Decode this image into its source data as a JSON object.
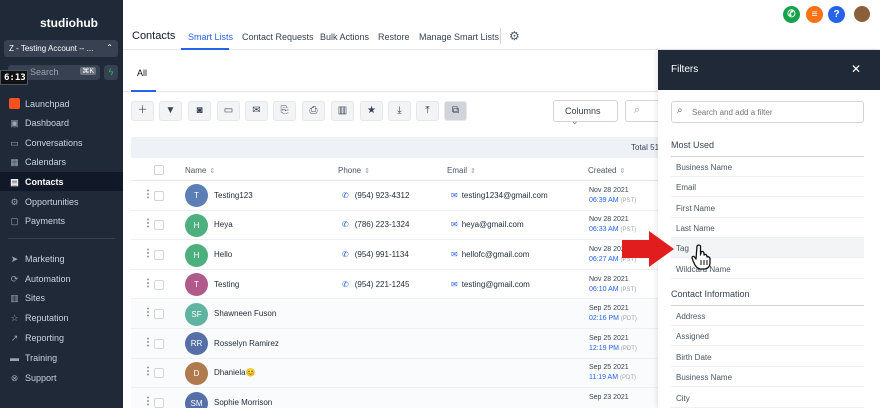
{
  "sidebar": {
    "logo": "studiohub",
    "account": "Z - Testing Account -- ...",
    "timer": "6:13",
    "search_placeholder": "Search",
    "search_kbd": "⌘K",
    "items": [
      {
        "label": "Launchpad",
        "icon": "launchpad-icon"
      },
      {
        "label": "Dashboard",
        "icon": "dashboard-icon"
      },
      {
        "label": "Conversations",
        "icon": "chat-icon"
      },
      {
        "label": "Calendars",
        "icon": "calendar-icon"
      },
      {
        "label": "Contacts",
        "icon": "contacts-icon",
        "active": true
      },
      {
        "label": "Opportunities",
        "icon": "opportunities-icon"
      },
      {
        "label": "Payments",
        "icon": "payments-icon"
      },
      {
        "label": "Marketing",
        "icon": "marketing-icon"
      },
      {
        "label": "Automation",
        "icon": "automation-icon"
      },
      {
        "label": "Sites",
        "icon": "sites-icon"
      },
      {
        "label": "Reputation",
        "icon": "star-icon"
      },
      {
        "label": "Reporting",
        "icon": "chart-icon"
      },
      {
        "label": "Training",
        "icon": "book-icon"
      },
      {
        "label": "Support",
        "icon": "support-icon"
      }
    ]
  },
  "header": {
    "title": "Contacts",
    "tabs": [
      "Smart Lists",
      "Contact Requests",
      "Bulk Actions",
      "Restore",
      "Manage Smart Lists"
    ],
    "active_tab": "Smart Lists",
    "circles": [
      {
        "icon": "phone-icon",
        "glyph": "✆",
        "color": "#16a34a"
      },
      {
        "icon": "list-icon",
        "glyph": "≡",
        "color": "#f97316"
      },
      {
        "icon": "help-icon",
        "glyph": "?",
        "color": "#2563eb"
      }
    ]
  },
  "subheader": {
    "tab": "All"
  },
  "toolbar": {
    "columns_label": "Columns",
    "total": "Total 51"
  },
  "table": {
    "headers": [
      "Name",
      "Phone",
      "Email",
      "Created"
    ],
    "rows": [
      {
        "initials": "T",
        "color": "#5b7fb5",
        "name": "Testing123",
        "phone": "(954) 923-4312",
        "email": "testing1234@gmail.com",
        "date": "Nov 28 2021",
        "time": "06:39 AM",
        "tz": "(PST)"
      },
      {
        "initials": "H",
        "color": "#4caf7d",
        "name": "Heya",
        "phone": "(786) 223-1324",
        "email": "heya@gmail.com",
        "date": "Nov 28 2021",
        "time": "06:33 AM",
        "tz": "(PST)"
      },
      {
        "initials": "H",
        "color": "#4caf7d",
        "name": "Hello",
        "phone": "(954) 991-1134",
        "email": "hellofc@gmail.com",
        "date": "Nov 28 2021",
        "time": "06:27 AM",
        "tz": "(PST)"
      },
      {
        "initials": "T",
        "color": "#b05a8c",
        "name": "Testing",
        "phone": "(954) 221-1245",
        "email": "testing@gmail.com",
        "date": "Nov 28 2021",
        "time": "06:10 AM",
        "tz": "(PST)"
      },
      {
        "initials": "SF",
        "color": "#5fb3a1",
        "name": "Shawneen Fuson",
        "phone": "",
        "email": "",
        "date": "Sep 25 2021",
        "time": "02:16 PM",
        "tz": "(PDT)"
      },
      {
        "initials": "RR",
        "color": "#5470a6",
        "name": "Rosselyn Ramirez",
        "phone": "",
        "email": "",
        "date": "Sep 25 2021",
        "time": "12:19 PM",
        "tz": "(PDT)"
      },
      {
        "initials": "D",
        "color": "#b07a4f",
        "name": "Dhaniela😊",
        "phone": "",
        "email": "",
        "date": "Sep 25 2021",
        "time": "11:19 AM",
        "tz": "(PDT)"
      },
      {
        "initials": "SM",
        "color": "#5470a6",
        "name": "Sophie Morrison",
        "phone": "",
        "email": "",
        "date": "Sep 23 2021",
        "time": "",
        "tz": ""
      }
    ]
  },
  "filters": {
    "title": "Filters",
    "search_placeholder": "Search and add a filter",
    "most_used_title": "Most Used",
    "most_used": [
      "Business Name",
      "Email",
      "First Name",
      "Last Name",
      "Tag",
      "Wildcard Name"
    ],
    "contact_info_title": "Contact Information",
    "contact_info": [
      "Address",
      "Assigned",
      "Birth Date",
      "Business Name",
      "City"
    ]
  },
  "colors": {
    "accent": "#2563eb",
    "sidebar": "#1f2937",
    "arrow": "#e11d1d"
  }
}
